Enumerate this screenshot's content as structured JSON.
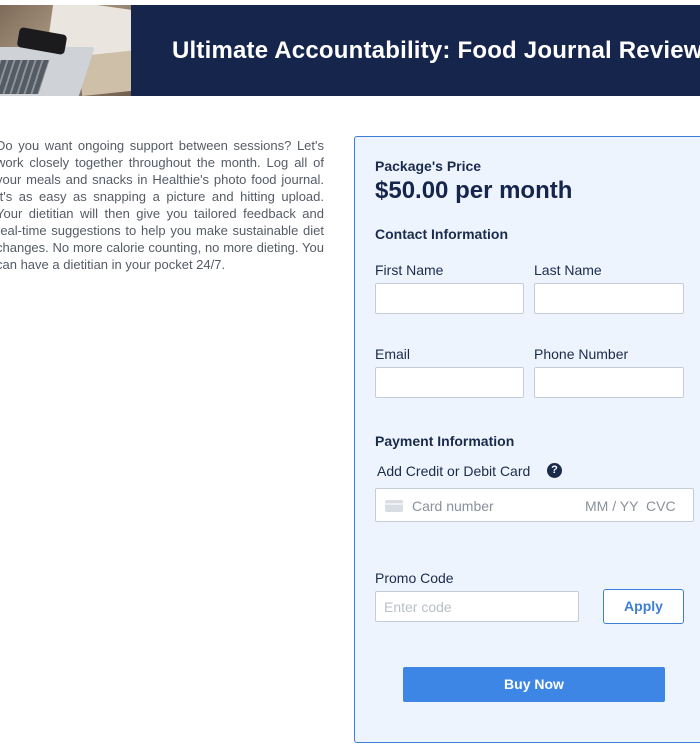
{
  "hero": {
    "title": "Ultimate Accountability: Food Journal Review"
  },
  "description": "Do you want ongoing support between sessions? Let's work closely together throughout the month. Log all of your meals and snacks in Healthie's photo food journal. It's as easy as snapping a picture and hitting upload. Your dietitian will then give you tailored feedback and real-time suggestions to help you make sustainable diet changes. No more calorie counting, no more dieting. You can have a dietitian in your pocket 24/7.",
  "package": {
    "price_label": "Package's Price",
    "price_value": "$50.00 per month"
  },
  "contact": {
    "heading": "Contact Information",
    "first_name_label": "First Name",
    "first_name_value": "",
    "last_name_label": "Last Name",
    "last_name_value": "",
    "email_label": "Email",
    "email_value": "",
    "phone_label": "Phone Number",
    "phone_value": ""
  },
  "payment": {
    "heading": "Payment Information",
    "card_label": "Add Credit or Debit Card",
    "help_glyph": "?",
    "card_number_placeholder": "Card number",
    "expiry_placeholder": "MM / YY",
    "cvc_placeholder": "CVC"
  },
  "promo": {
    "label": "Promo Code",
    "placeholder": "Enter code",
    "apply_label": "Apply"
  },
  "buy_label": "Buy Now",
  "colors": {
    "banner": "#16254c",
    "accent": "#3d86e6",
    "card_bg": "#eef4fd"
  }
}
